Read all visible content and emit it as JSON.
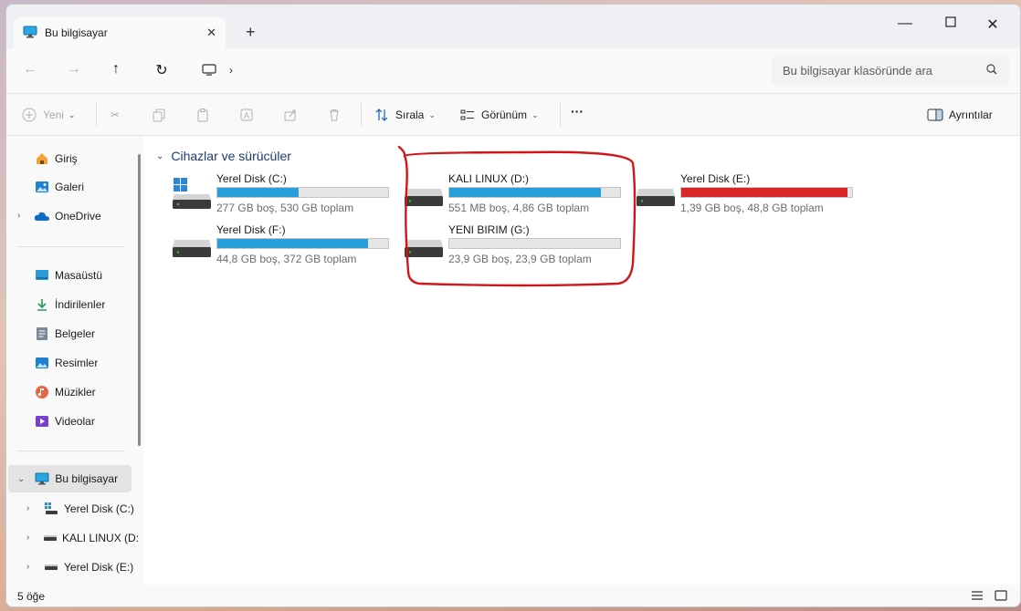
{
  "window": {
    "tab_title": "Bu bilgisayar",
    "icons": {
      "tab": "computer-icon",
      "close": "close-icon",
      "new_tab": "plus-icon",
      "minimize": "minimize-icon",
      "maximize": "maximize-icon",
      "close_window": "close-icon"
    }
  },
  "address": {
    "search_placeholder": "Bu bilgisayar klasöründe ara"
  },
  "toolbar": {
    "new_label": "Yeni",
    "sort_label": "Sırala",
    "view_label": "Görünüm",
    "more_label": "···",
    "details_label": "Ayrıntılar"
  },
  "sidebar": {
    "top": [
      {
        "label": "Giriş",
        "icon": "home-icon"
      },
      {
        "label": "Galeri",
        "icon": "gallery-icon"
      },
      {
        "label": "OneDrive",
        "icon": "cloud-icon"
      }
    ],
    "pinned": [
      {
        "label": "Masaüstü",
        "icon": "desktop-icon"
      },
      {
        "label": "İndirilenler",
        "icon": "download-icon"
      },
      {
        "label": "Belgeler",
        "icon": "documents-icon"
      },
      {
        "label": "Resimler",
        "icon": "pictures-icon"
      },
      {
        "label": "Müzikler",
        "icon": "music-icon"
      },
      {
        "label": "Videolar",
        "icon": "videos-icon"
      }
    ],
    "this_pc": {
      "label": "Bu bilgisayar",
      "icon": "computer-icon"
    },
    "drives": [
      {
        "label": "Yerel Disk (C:)"
      },
      {
        "label": "KALI LINUX (D:"
      },
      {
        "label": "Yerel Disk (E:)"
      }
    ]
  },
  "main": {
    "group_title": "Cihazlar ve sürücüler",
    "drives": [
      {
        "name": "Yerel Disk (C:)",
        "info": "277 GB boş, 530 GB toplam",
        "used_fraction": 0.477,
        "color": "#26a0da",
        "icon": "windows-drive-icon"
      },
      {
        "name": "KALI LINUX (D:)",
        "info": "551 MB boş, 4,86 GB toplam",
        "used_fraction": 0.889,
        "color": "#26a0da",
        "icon": "drive-icon"
      },
      {
        "name": "Yerel Disk (E:)",
        "info": "1,39 GB boş, 48,8 GB toplam",
        "used_fraction": 0.972,
        "color": "#da2626",
        "icon": "drive-icon"
      },
      {
        "name": "Yerel Disk (F:)",
        "info": "44,8 GB boş, 372 GB toplam",
        "used_fraction": 0.88,
        "color": "#26a0da",
        "icon": "drive-icon"
      },
      {
        "name": "YENI BIRIM (G:)",
        "info": "23,9 GB boş, 23,9 GB toplam",
        "used_fraction": 0.0,
        "color": "#26a0da",
        "icon": "drive-icon"
      }
    ]
  },
  "status": {
    "item_count": "5 öğe"
  },
  "colors": {
    "accent": "#26a0da",
    "warning": "#da2626",
    "annotation": "#d0161b"
  }
}
